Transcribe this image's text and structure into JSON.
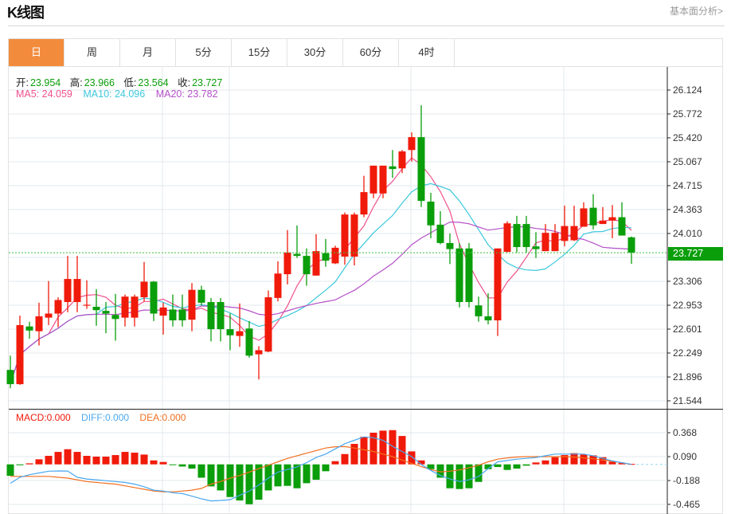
{
  "header": {
    "title": "K线图",
    "link": "基本面分析>"
  },
  "tabs": [
    {
      "label": "日",
      "active": true
    },
    {
      "label": "周"
    },
    {
      "label": "月"
    },
    {
      "label": "5分"
    },
    {
      "label": "15分"
    },
    {
      "label": "30分"
    },
    {
      "label": "60分"
    },
    {
      "label": "4时"
    }
  ],
  "ohlc_info": {
    "open_label": "开:",
    "open": "23.954",
    "high_label": "高:",
    "high": "23.966",
    "low_label": "低:",
    "low": "23.564",
    "close_label": "收:",
    "close": "23.727"
  },
  "ma_info": {
    "ma5": "MA5: 24.059",
    "ma10": "MA10: 24.096",
    "ma20": "MA20: 23.782"
  },
  "macd_info": {
    "macd": "MACD:0.000",
    "diff": "DIFF:0.000",
    "dea": "DEA:0.000"
  },
  "current_price": "23.727",
  "colors": {
    "up": "#f01a0a",
    "down": "#0a9e0a",
    "ma5": "#f0508c",
    "ma10": "#3cc8dc",
    "ma20": "#b450c8",
    "diff": "#4aa8f0",
    "dea": "#f27020",
    "active_tab": "#f28c3c"
  },
  "chart_data": [
    {
      "type": "candlestick",
      "ylim": [
        21.544,
        26.124
      ],
      "y_ticks": [
        "26.124",
        "25.772",
        "25.420",
        "25.067",
        "24.715",
        "24.363",
        "24.010",
        "23.306",
        "22.953",
        "22.601",
        "22.249",
        "21.896",
        "21.544"
      ],
      "grid": true,
      "candles": [
        [
          22.0,
          22.21,
          21.73,
          21.79
        ],
        [
          21.79,
          22.8,
          21.78,
          22.66
        ],
        [
          22.64,
          22.71,
          22.46,
          22.58
        ],
        [
          22.57,
          22.99,
          22.36,
          22.79
        ],
        [
          22.77,
          23.31,
          22.66,
          22.83
        ],
        [
          22.83,
          23.07,
          22.63,
          23.03
        ],
        [
          23.0,
          23.68,
          22.85,
          23.34
        ],
        [
          23.0,
          23.68,
          22.85,
          23.34
        ],
        [
          22.95,
          23.32,
          22.9,
          22.96
        ],
        [
          22.93,
          23.19,
          22.65,
          22.88
        ],
        [
          22.87,
          23.0,
          22.54,
          22.83
        ],
        [
          22.81,
          23.12,
          22.43,
          22.75
        ],
        [
          22.77,
          23.11,
          22.64,
          23.08
        ],
        [
          22.77,
          23.11,
          22.64,
          23.08
        ],
        [
          23.07,
          23.59,
          23.01,
          23.3
        ],
        [
          23.3,
          23.31,
          22.72,
          22.83
        ],
        [
          22.8,
          22.99,
          22.52,
          22.92
        ],
        [
          22.89,
          23.11,
          22.64,
          22.73
        ],
        [
          22.89,
          23.11,
          22.64,
          22.73
        ],
        [
          22.74,
          23.28,
          22.57,
          23.18
        ],
        [
          23.18,
          23.24,
          22.95,
          22.99
        ],
        [
          23.0,
          23.06,
          22.42,
          22.6
        ],
        [
          23.0,
          23.06,
          22.42,
          22.6
        ],
        [
          22.6,
          22.83,
          22.29,
          22.51
        ],
        [
          22.5,
          22.98,
          22.34,
          22.57
        ],
        [
          22.61,
          22.72,
          22.18,
          22.21
        ],
        [
          22.23,
          22.35,
          21.86,
          22.29
        ],
        [
          22.27,
          23.17,
          22.26,
          23.07
        ],
        [
          23.06,
          23.6,
          23.01,
          23.42
        ],
        [
          23.41,
          24.06,
          23.26,
          23.73
        ],
        [
          23.71,
          24.13,
          23.65,
          23.68
        ],
        [
          23.68,
          23.79,
          23.24,
          23.41
        ],
        [
          23.39,
          24.0,
          23.39,
          23.75
        ],
        [
          23.72,
          23.93,
          23.52,
          23.61
        ],
        [
          23.57,
          23.83,
          23.56,
          23.8
        ],
        [
          23.67,
          24.32,
          23.55,
          24.29
        ],
        [
          23.67,
          24.32,
          23.54,
          24.29
        ],
        [
          24.29,
          24.86,
          24.25,
          24.62
        ],
        [
          24.6,
          25.01,
          24.53,
          25.01
        ],
        [
          24.6,
          25.01,
          24.53,
          25.01
        ],
        [
          25.0,
          25.24,
          24.83,
          24.96
        ],
        [
          24.97,
          25.24,
          24.9,
          25.22
        ],
        [
          25.24,
          25.5,
          25.07,
          25.43
        ],
        [
          25.43,
          25.9,
          24.4,
          24.49
        ],
        [
          24.48,
          24.61,
          23.94,
          24.13
        ],
        [
          24.14,
          24.34,
          23.85,
          23.87
        ],
        [
          23.87,
          24.01,
          23.56,
          23.78
        ],
        [
          23.79,
          23.87,
          22.92,
          23.0
        ],
        [
          23.79,
          23.87,
          22.92,
          23.0
        ],
        [
          22.95,
          23.08,
          22.71,
          22.79
        ],
        [
          22.79,
          23.13,
          22.67,
          22.73
        ],
        [
          22.73,
          23.79,
          22.5,
          23.79
        ],
        [
          23.74,
          24.19,
          23.73,
          24.16
        ],
        [
          24.15,
          24.27,
          23.73,
          23.81
        ],
        [
          24.15,
          24.27,
          23.73,
          23.81
        ],
        [
          23.82,
          24.03,
          23.65,
          23.78
        ],
        [
          23.75,
          24.15,
          23.75,
          24.02
        ],
        [
          23.75,
          24.15,
          23.75,
          24.02
        ],
        [
          23.9,
          24.42,
          23.82,
          24.12
        ],
        [
          23.91,
          24.42,
          23.9,
          24.12
        ],
        [
          24.11,
          24.47,
          24.11,
          24.38
        ],
        [
          24.39,
          24.59,
          24.07,
          24.13
        ],
        [
          24.15,
          24.4,
          24.15,
          24.2
        ],
        [
          24.2,
          24.43,
          23.94,
          24.25
        ],
        [
          24.25,
          24.47,
          23.98,
          23.98
        ],
        [
          23.954,
          23.966,
          23.564,
          23.727
        ]
      ],
      "ma_periods": [
        5,
        10,
        20
      ]
    },
    {
      "type": "macd",
      "ylim": [
        -0.52,
        0.44
      ],
      "y_ticks": [
        "0.368",
        "0.090",
        "-0.188",
        "-0.465"
      ],
      "macd": [
        -0.133,
        -0.01,
        0.012,
        0.059,
        0.099,
        0.145,
        0.176,
        0.145,
        0.099,
        0.09,
        0.09,
        0.108,
        0.145,
        0.136,
        0.114,
        0.046,
        0.028,
        -0.009,
        -0.025,
        -0.049,
        -0.155,
        -0.256,
        -0.303,
        -0.38,
        -0.42,
        -0.464,
        -0.411,
        -0.303,
        -0.256,
        -0.25,
        -0.278,
        -0.219,
        -0.179,
        -0.08,
        0.037,
        0.12,
        0.238,
        0.321,
        0.368,
        0.392,
        0.398,
        0.33,
        0.151,
        0.046,
        -0.056,
        -0.155,
        -0.278,
        -0.287,
        -0.278,
        -0.204,
        -0.056,
        -0.031,
        -0.065,
        -0.049,
        -0.015,
        0.022,
        0.046,
        0.083,
        0.108,
        0.13,
        0.114,
        0.105,
        0.083,
        0.031,
        0.015,
        0.005
      ],
      "diff": [
        -0.22,
        -0.15,
        -0.12,
        -0.1,
        -0.08,
        -0.077,
        -0.078,
        -0.15,
        -0.17,
        -0.18,
        -0.19,
        -0.2,
        -0.21,
        -0.23,
        -0.26,
        -0.3,
        -0.31,
        -0.33,
        -0.34,
        -0.37,
        -0.4,
        -0.425,
        -0.42,
        -0.41,
        -0.36,
        -0.31,
        -0.24,
        -0.16,
        -0.09,
        -0.06,
        -0.03,
        0.02,
        0.08,
        0.12,
        0.18,
        0.24,
        0.28,
        0.32,
        0.31,
        0.28,
        0.21,
        0.15,
        0.09,
        0.0,
        -0.07,
        -0.13,
        -0.17,
        -0.2,
        -0.18,
        -0.14,
        -0.05,
        0.03,
        0.045,
        0.06,
        0.07,
        0.08,
        0.1,
        0.12,
        0.12,
        0.12,
        0.12,
        0.1,
        0.07,
        0.04,
        0.02,
        0.0
      ],
      "dea": [
        -0.14,
        -0.14,
        -0.14,
        -0.14,
        -0.14,
        -0.15,
        -0.16,
        -0.18,
        -0.2,
        -0.21,
        -0.22,
        -0.23,
        -0.25,
        -0.27,
        -0.29,
        -0.31,
        -0.32,
        -0.32,
        -0.31,
        -0.3,
        -0.28,
        -0.23,
        -0.2,
        -0.16,
        -0.13,
        -0.09,
        -0.05,
        -0.01,
        0.03,
        0.07,
        0.1,
        0.13,
        0.16,
        0.19,
        0.205,
        0.207,
        0.19,
        0.17,
        0.15,
        0.12,
        0.09,
        0.05,
        0.01,
        -0.025,
        -0.06,
        -0.087,
        -0.08,
        -0.065,
        -0.04,
        -0.01,
        0.03,
        0.06,
        0.075,
        0.085,
        0.09,
        0.09,
        0.09,
        0.09,
        0.09,
        0.085,
        0.075,
        0.065,
        0.05,
        0.035,
        0.02,
        0.0
      ]
    }
  ]
}
